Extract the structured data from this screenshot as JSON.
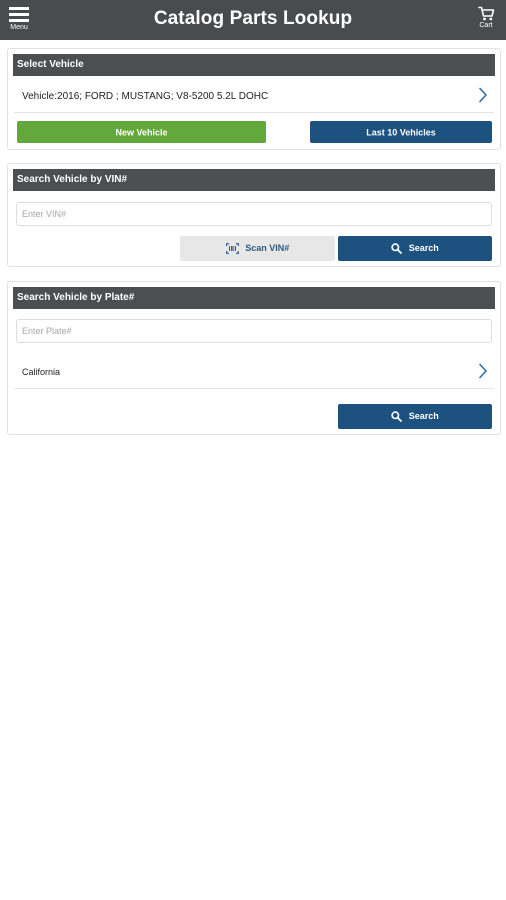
{
  "header": {
    "title": "Catalog Parts Lookup",
    "menu_label": "Menu",
    "cart_label": "Cart",
    "menu_icon": "hamburger-icon",
    "cart_icon": "cart-icon"
  },
  "select_vehicle": {
    "heading": "Select Vehicle",
    "vehicle_text": "Vehicle:2016; FORD ; MUSTANG; V8-5200 5.2L DOHC",
    "new_vehicle_label": "New Vehicle",
    "last_vehicles_label": "Last 10 Vehicles"
  },
  "vin_search": {
    "heading": "Search Vehicle by VIN#",
    "placeholder": "Enter VIN#",
    "value": "",
    "scan_label": "Scan VIN#",
    "search_label": "Search"
  },
  "plate_search": {
    "heading": "Search Vehicle by Plate#",
    "placeholder": "Enter Plate#",
    "value": "",
    "state": "California",
    "search_label": "Search"
  },
  "colors": {
    "appbar": "#4a4b4d",
    "section_header": "#4d4e50",
    "primary_blue": "#1d5180",
    "green": "#62a83b",
    "chevron": "#2f6fa3"
  }
}
